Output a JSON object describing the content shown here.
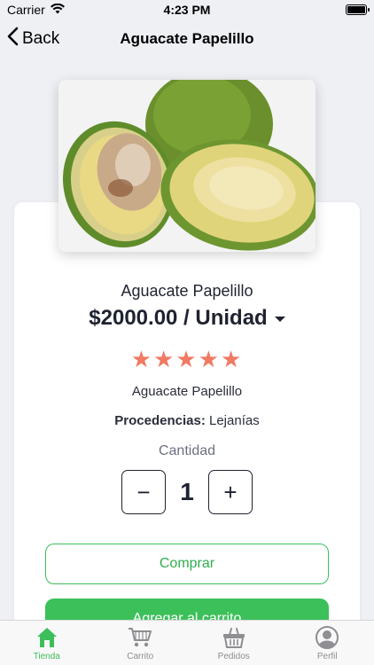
{
  "status_bar": {
    "carrier": "Carrier",
    "time": "4:23 PM"
  },
  "nav": {
    "back_label": "Back",
    "title": "Aguacate Papelillo"
  },
  "product": {
    "name": "Aguacate Papelillo",
    "price": "$2000.00 / Unidad",
    "rating_stars": "★★★★★",
    "rating": 5,
    "description": "Aguacate Papelillo",
    "origin_label": "Procedencias:",
    "origin_value": "Lejanías"
  },
  "quantity": {
    "label": "Cantidad",
    "value": "1",
    "decrement": "−",
    "increment": "+"
  },
  "actions": {
    "buy_label": "Comprar",
    "add_to_cart_label": "Agregar al carrito"
  },
  "tabs": [
    {
      "label": "Tienda",
      "icon": "store-icon",
      "active": true
    },
    {
      "label": "Carrito",
      "icon": "cart-icon",
      "active": false
    },
    {
      "label": "Pedidos",
      "icon": "basket-icon",
      "active": false
    },
    {
      "label": "Perfil",
      "icon": "profile-icon",
      "active": false
    }
  ],
  "colors": {
    "accent": "#3cbf5a",
    "star": "#f07a63",
    "text": "#1f2230",
    "background": "#eef0f4"
  }
}
